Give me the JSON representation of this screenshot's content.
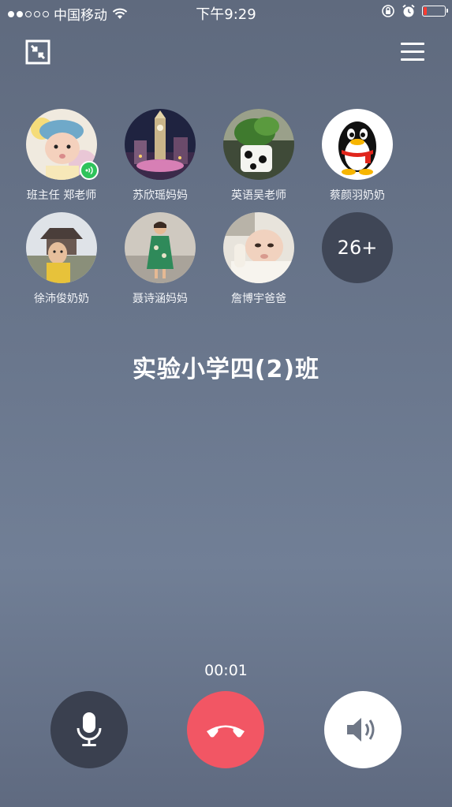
{
  "status_bar": {
    "carrier": "中国移动",
    "time": "下午9:29"
  },
  "call": {
    "group_name": "实验小学四(2)班",
    "duration": "00:01",
    "more_count": "26+"
  },
  "members": [
    {
      "name": "班主任 郑老师",
      "speaking": true
    },
    {
      "name": "苏欣瑶妈妈",
      "speaking": false
    },
    {
      "name": "英语吴老师",
      "speaking": false
    },
    {
      "name": "蔡颜羽奶奶",
      "speaking": false
    },
    {
      "name": "徐沛俊奶奶",
      "speaking": false
    },
    {
      "name": "聂诗涵妈妈",
      "speaking": false
    },
    {
      "name": "詹博宇爸爸",
      "speaking": false
    }
  ],
  "colors": {
    "hangup": "#f25664",
    "speaking": "#2ec35b",
    "mic_button": "#3a404f",
    "speaker_button": "#ffffff"
  },
  "icons": {
    "minimize": "minimize-icon",
    "menu": "menu-icon",
    "mic": "microphone-icon",
    "hangup": "hangup-icon",
    "speaker": "speaker-icon"
  }
}
